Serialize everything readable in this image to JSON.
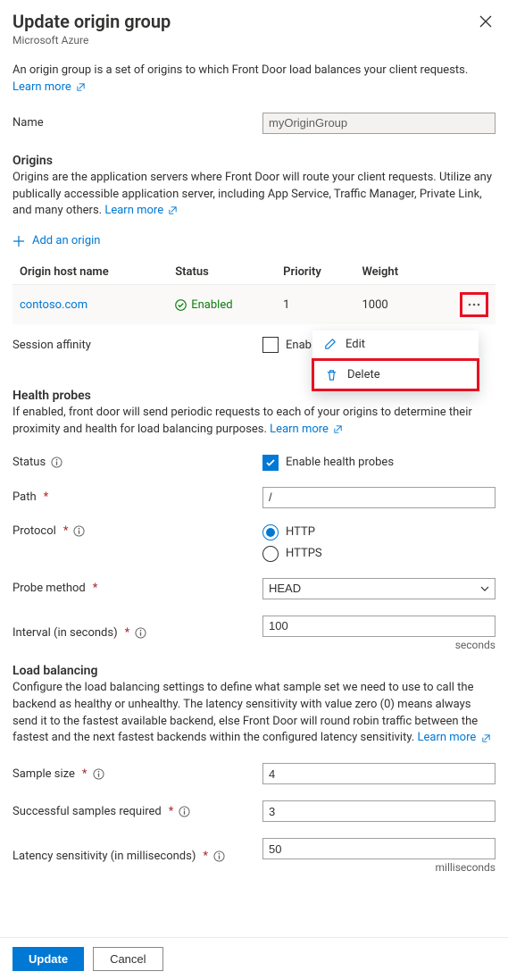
{
  "header": {
    "title": "Update origin group",
    "subtitle": "Microsoft Azure"
  },
  "intro": {
    "text": "An origin group is a set of origins to which Front Door load balances your client requests.",
    "learn_more": "Learn more"
  },
  "name": {
    "label": "Name",
    "value": "myOriginGroup"
  },
  "origins": {
    "title": "Origins",
    "desc": "Origins are the application servers where Front Door will route your client requests. Utilize any publically accessible application server, including App Service, Traffic Manager, Private Link, and many others.",
    "learn_more": "Learn more",
    "add_label": "Add an origin",
    "columns": {
      "host": "Origin host name",
      "status": "Status",
      "priority": "Priority",
      "weight": "Weight"
    },
    "rows": [
      {
        "host": "contoso.com",
        "status": "Enabled",
        "priority": "1",
        "weight": "1000"
      }
    ]
  },
  "session_affinity": {
    "label": "Session affinity",
    "checkbox_label": "Enable se"
  },
  "context_menu": {
    "edit": "Edit",
    "delete": "Delete"
  },
  "health": {
    "title": "Health probes",
    "desc": "If enabled, front door will send periodic requests to each of your origins to determine their proximity and health for load balancing purposes.",
    "learn_more": "Learn more",
    "status_label": "Status",
    "status_checkbox": "Enable health probes",
    "path_label": "Path",
    "path_value": "/",
    "protocol_label": "Protocol",
    "protocol_http": "HTTP",
    "protocol_https": "HTTPS",
    "probe_method_label": "Probe method",
    "probe_method_value": "HEAD",
    "interval_label": "Interval (in seconds)",
    "interval_value": "100",
    "interval_unit": "seconds"
  },
  "load_balancing": {
    "title": "Load balancing",
    "desc": "Configure the load balancing settings to define what sample set we need to use to call the backend as healthy or unhealthy. The latency sensitivity with value zero (0) means always send it to the fastest available backend, else Front Door will round robin traffic between the fastest and the next fastest backends within the configured latency sensitivity.",
    "learn_more": "Learn more",
    "sample_size_label": "Sample size",
    "sample_size_value": "4",
    "successful_label": "Successful samples required",
    "successful_value": "3",
    "latency_label": "Latency sensitivity (in milliseconds)",
    "latency_value": "50",
    "latency_unit": "milliseconds"
  },
  "footer": {
    "update": "Update",
    "cancel": "Cancel"
  }
}
